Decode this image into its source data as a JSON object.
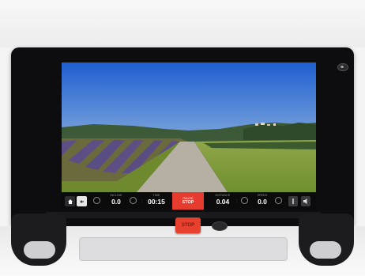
{
  "control_bar": {
    "incline": {
      "label": "INCLINE",
      "value": "0.0"
    },
    "time": {
      "label": "TIME",
      "value": "00:15"
    },
    "stop_button": {
      "small": "PAUSE",
      "big": "STOP"
    },
    "distance": {
      "label": "DISTANCE",
      "value": "0.04"
    },
    "speed": {
      "label": "SPEED",
      "value": "0.0"
    }
  },
  "hardware": {
    "stop_label": "STOP"
  },
  "colors": {
    "accent_red": "#e63c2f",
    "sky_blue": "#2f6cd6"
  }
}
